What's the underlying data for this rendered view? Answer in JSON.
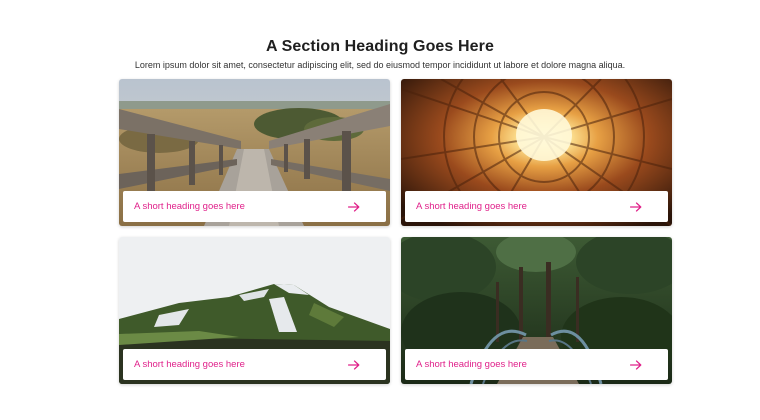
{
  "section": {
    "heading": "A Section Heading Goes Here",
    "subtitle": "Lorem ipsum dolor sit amet, consectetur adipiscing elit, sed do eiusmod tempor incididunt ut labore et dolore magna aliqua."
  },
  "cards": [
    {
      "title": "A short heading goes here",
      "image": "wooden-boardwalk-photo",
      "icon": "arrow-right-icon"
    },
    {
      "title": "A short heading goes here",
      "image": "courtyard-sky-photo",
      "icon": "arrow-right-icon"
    },
    {
      "title": "A short heading goes here",
      "image": "mossy-mountain-photo",
      "icon": "arrow-right-icon"
    },
    {
      "title": "A short heading goes here",
      "image": "forest-bridge-photo",
      "icon": "arrow-right-icon"
    }
  ],
  "colors": {
    "accent": "#e0218a",
    "heading": "#1f1f1f",
    "background": "#ffffff"
  }
}
